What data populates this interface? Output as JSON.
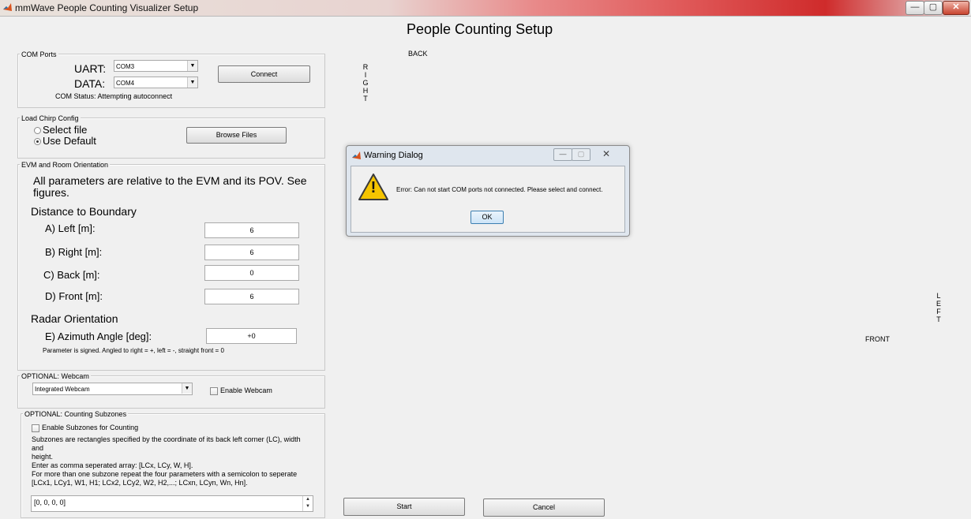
{
  "window": {
    "title": "mmWave People Counting Visualizer Setup",
    "minimize_glyph": "—",
    "maximize_glyph": "▢",
    "close_glyph": "✕"
  },
  "page_title": "People Counting Setup",
  "com_ports": {
    "title": "COM Ports",
    "uart_label": "UART:",
    "uart_value": "COM3",
    "data_label": "DATA:",
    "data_value": "COM4",
    "connect_label": "Connect",
    "status": "COM Status: Attempting autoconnect"
  },
  "chirp_config": {
    "title": "Load Chirp Config",
    "select_file_label": "Select file",
    "use_default_label": "Use Default",
    "selected": "Use Default",
    "browse_label": "Browse Files"
  },
  "evm": {
    "title": "EVM and Room Orientation",
    "intro_line1": "All parameters are relative to the EVM and its POV.  See",
    "intro_line2": "figures.",
    "distance_heading": "Distance to Boundary",
    "left_label": "A) Left [m]:",
    "left_value": "6",
    "right_label": "B) Right [m]:",
    "right_value": "6",
    "back_label": "C) Back [m]:",
    "back_value": "0",
    "front_label": "D) Front [m]:",
    "front_value": "6",
    "radar_heading": "Radar Orientation",
    "azimuth_label": "E) Azimuth Angle [deg]:",
    "azimuth_value": "+0",
    "azimuth_note": "Parameter is signed. Angled to right = +, left = -, straight front = 0"
  },
  "webcam": {
    "title": "OPTIONAL: Webcam",
    "selected": "Integrated Webcam",
    "enable_label": "Enable Webcam",
    "enabled": false
  },
  "subzones": {
    "title": "OPTIONAL: Counting Subzones",
    "enable_label": "Enable Subzones for Counting",
    "enabled": false,
    "desc_line1": "Subzones are rectangles specified by the coordinate of its back left corner (LC), width and",
    "desc_line2": "height.",
    "desc_line3": "Enter as comma seperated array: [LCx, LCy, W, H].",
    "desc_line4": "For more than one subzone repeat the four parameters with a semicolon to seperate",
    "desc_line5": "[LCx1, LCy1, W1, H1; LCx2, LCy2, W2, H2,...; LCxn, LCyn, Wn, Hn].",
    "input_value": "[0, 0, 0, 0]"
  },
  "room": {
    "back": "BACK",
    "front": "FRONT",
    "right_letters": [
      "R",
      "I",
      "G",
      "H",
      "T"
    ],
    "left_letters": [
      "L",
      "E",
      "F",
      "T"
    ]
  },
  "actions": {
    "start_label": "Start",
    "cancel_label": "Cancel"
  },
  "warning_dialog": {
    "title": "Warning Dialog",
    "message": "Error: Can not start COM ports not connected. Please select and connect.",
    "ok_label": "OK",
    "warning_glyph": "!"
  },
  "colors": {
    "accent_blue": "#3c7fb1",
    "warning_yellow": "#f5c400"
  }
}
